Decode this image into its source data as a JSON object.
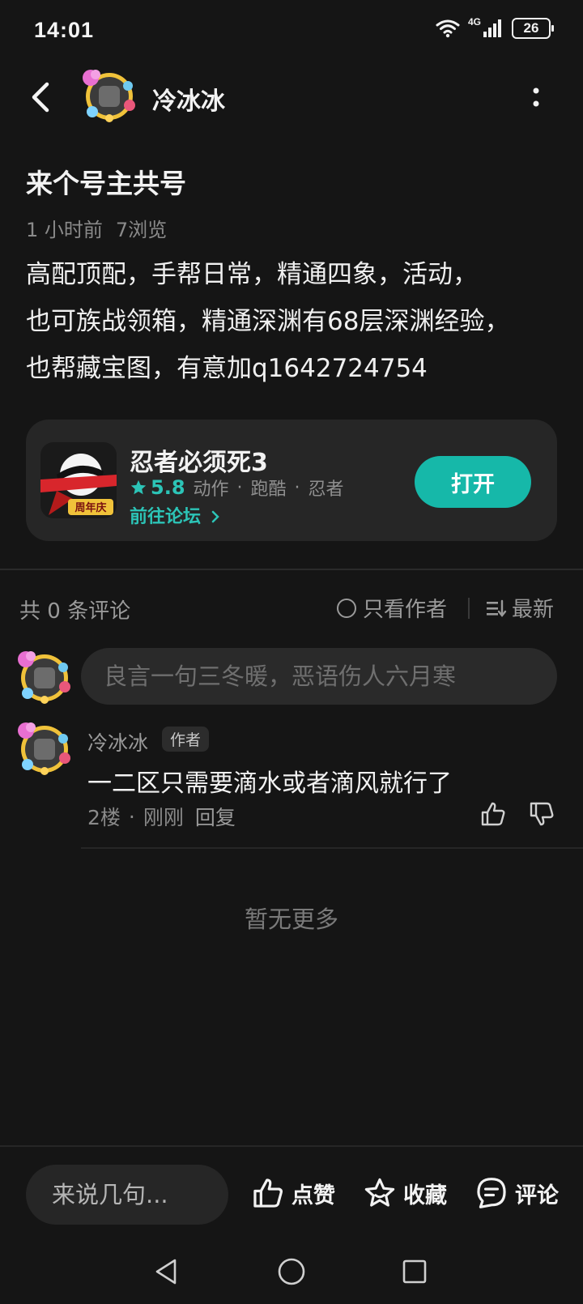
{
  "status_bar": {
    "time": "14:01",
    "network": "4G",
    "battery": "26",
    "icons": [
      "wifi-icon",
      "signal-icon",
      "battery-icon"
    ]
  },
  "header": {
    "author_name": "冷冰冰",
    "icons": [
      "back-arrow-icon",
      "more-vertical-icon"
    ]
  },
  "post": {
    "title": "来个号主共号",
    "time_ago": "1 小时前",
    "views": "7浏览",
    "body": "高配顶配，手帮日常，精通四象，活动，\n也可族战领箱，精通深渊有68层深渊经验，\n也帮藏宝图，有意加q1642724754"
  },
  "game_card": {
    "name": "忍者必须死3",
    "rating": "5.8",
    "tags": [
      "动作",
      "跑酷",
      "忍者"
    ],
    "tag_separator": "·",
    "forum_link": "前往论坛",
    "open_button": "打开",
    "icon_badge": "周年庆",
    "accent_color": "#16b8a9"
  },
  "comments": {
    "count_label": "共 0 条评论",
    "author_only_label": "只看作者",
    "sort_label": "最新",
    "input_placeholder": "良言一句三冬暖，恶语伤人六月寒",
    "items": [
      {
        "author": "冷冰冰",
        "badge": "作者",
        "text": "一二区只需要滴水或者滴风就行了",
        "floor": "2楼",
        "time": "刚刚",
        "reply": "回复"
      }
    ],
    "no_more": "暂无更多"
  },
  "bottom_bar": {
    "input_placeholder": "来说几句...",
    "like": "点赞",
    "favorite": "收藏",
    "comment": "评论"
  },
  "nav_bar": {
    "icons": [
      "nav-back-icon",
      "nav-home-icon",
      "nav-recent-icon"
    ]
  }
}
